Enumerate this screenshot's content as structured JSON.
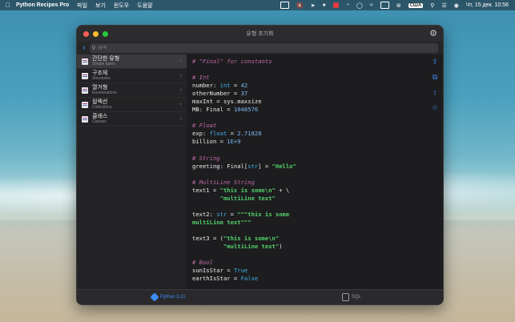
{
  "menubar": {
    "app_name": "Python Recipes Pro",
    "menus": [
      "파일",
      "보기",
      "윈도우",
      "도움말"
    ],
    "input_badge": "США",
    "clock": "Чт, 15 дек.  10:56"
  },
  "window": {
    "title": "유형 초기화",
    "search_placeholder": "검색"
  },
  "sidebar": {
    "items": [
      {
        "title": "간단한 유형",
        "subtitle": "Simple types"
      },
      {
        "title": "구조체",
        "subtitle": "Structures"
      },
      {
        "title": "열거형",
        "subtitle": "Enumerations"
      },
      {
        "title": "컬렉션",
        "subtitle": "Collections"
      },
      {
        "title": "클래스",
        "subtitle": "Classes"
      }
    ]
  },
  "code": {
    "lines": [
      [
        {
          "t": "# \"Final\" for constants",
          "c": "cm"
        }
      ],
      [],
      [
        {
          "t": "# Int",
          "c": "cm"
        }
      ],
      [
        {
          "t": "number: "
        },
        {
          "t": "int",
          "c": "kw"
        },
        {
          "t": " = "
        },
        {
          "t": "42",
          "c": "num"
        }
      ],
      [
        {
          "t": "otherNumber = "
        },
        {
          "t": "37",
          "c": "num"
        }
      ],
      [
        {
          "t": "maxInt = sys.maxsize"
        }
      ],
      [
        {
          "t": "MB: Final = "
        },
        {
          "t": "1048576",
          "c": "num"
        }
      ],
      [],
      [
        {
          "t": "# Float",
          "c": "cm"
        }
      ],
      [
        {
          "t": "exp: "
        },
        {
          "t": "float",
          "c": "kw"
        },
        {
          "t": " = "
        },
        {
          "t": "2.71828",
          "c": "num"
        }
      ],
      [
        {
          "t": "billion = "
        },
        {
          "t": "1E+9",
          "c": "num"
        }
      ],
      [],
      [
        {
          "t": "# String",
          "c": "cm"
        }
      ],
      [
        {
          "t": "greeting: Final["
        },
        {
          "t": "str",
          "c": "kw"
        },
        {
          "t": "] = "
        },
        {
          "t": "\"Hello\"",
          "c": "str"
        }
      ],
      [],
      [
        {
          "t": "# MultiLine String",
          "c": "cm"
        }
      ],
      [
        {
          "t": "text1 = "
        },
        {
          "t": "\"this is some\\n\"",
          "c": "str"
        },
        {
          "t": " + \\"
        }
      ],
      [
        {
          "t": "        "
        },
        {
          "t": "\"multiLine text\"",
          "c": "str"
        }
      ],
      [],
      [
        {
          "t": "text2: "
        },
        {
          "t": "str",
          "c": "kw"
        },
        {
          "t": " = "
        },
        {
          "t": "\"\"\"this is some",
          "c": "str"
        }
      ],
      [
        {
          "t": "multiLine text\"\"\"",
          "c": "str"
        }
      ],
      [],
      [
        {
          "t": "text3 = ("
        },
        {
          "t": "\"this is some\\n\"",
          "c": "str"
        }
      ],
      [
        {
          "t": "         "
        },
        {
          "t": "\"multiLine text\"",
          "c": "str"
        },
        {
          "t": ")"
        }
      ],
      [],
      [
        {
          "t": "# Bool",
          "c": "cm"
        }
      ],
      [
        {
          "t": "sunIsStar = "
        },
        {
          "t": "True",
          "c": "bool"
        }
      ],
      [
        {
          "t": "earthIsStar = "
        },
        {
          "t": "False",
          "c": "bool"
        }
      ]
    ]
  },
  "right_toolbar": [
    {
      "icon": "share-icon"
    },
    {
      "icon": "copy-icon"
    },
    {
      "icon": "text-size-icon"
    },
    {
      "icon": "favorite-star-icon"
    }
  ],
  "bottom_tabs": [
    {
      "label": "Python 3.11",
      "icon": "python-icon",
      "active": true
    },
    {
      "label": "SQL",
      "icon": "database-icon",
      "active": false
    }
  ],
  "colors": {
    "accent": "#3a8cf5",
    "comment": "#c068a8",
    "keyword": "#3fb0e8",
    "string": "#53d06a",
    "number": "#7fb8f0"
  }
}
